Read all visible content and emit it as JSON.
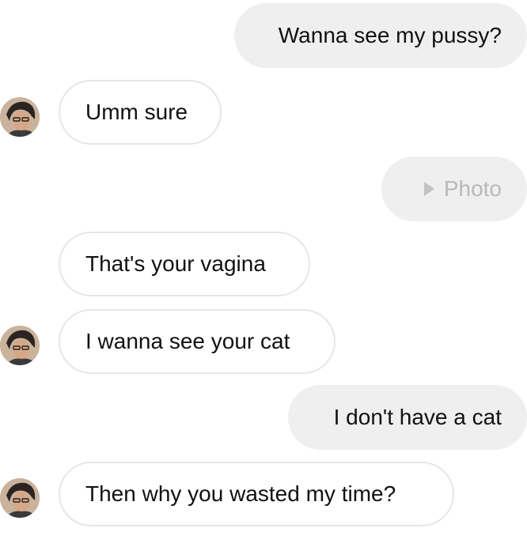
{
  "thread": {
    "messages": [
      {
        "sender": "me",
        "text": "Wanna see my pussy?"
      },
      {
        "sender": "them",
        "text": "Umm sure"
      },
      {
        "sender": "me",
        "type": "photo",
        "text": "Photo",
        "icon": "play-icon"
      },
      {
        "sender": "them",
        "text": "That's your vagina"
      },
      {
        "sender": "them",
        "text": "I wanna see your cat"
      },
      {
        "sender": "me",
        "text": "I don't have a cat"
      },
      {
        "sender": "them",
        "text": "Then why you wasted my time?"
      }
    ]
  },
  "colors": {
    "outgoing_bubble": "#efefef",
    "incoming_bubble_border": "#e6e6e6",
    "text": "#111111",
    "photo_label": "#b9b9b9"
  }
}
